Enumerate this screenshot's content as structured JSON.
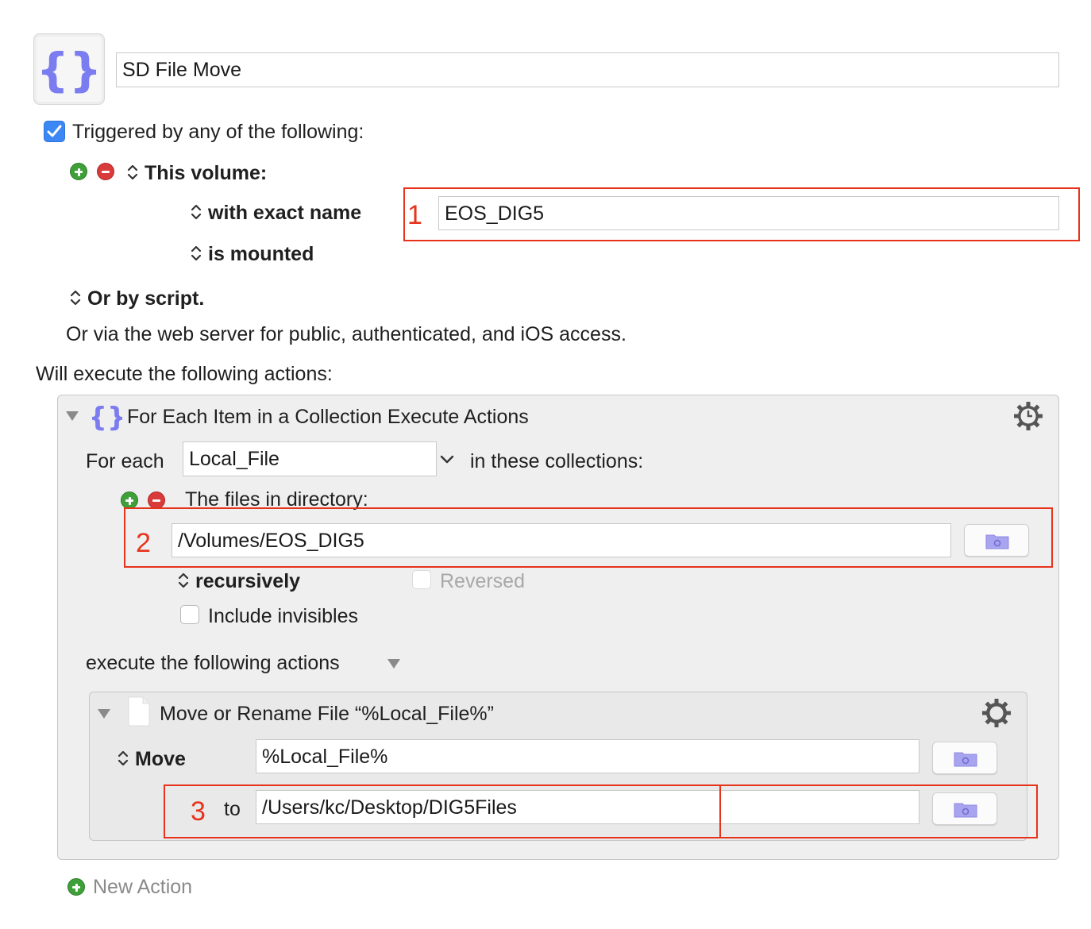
{
  "macro": {
    "icon": "curly-braces-icon",
    "name": "SD File Move"
  },
  "trigger": {
    "checked": true,
    "label": "Triggered by any of the following:",
    "volume_label": "This volume:",
    "condition_label": "with exact name",
    "volume_name": "EOS_DIG5",
    "state_label": "is mounted",
    "script_label": "Or by script.",
    "webserver_text": "Or via the web server for public, authenticated, and iOS access."
  },
  "actions_label": "Will execute the following actions:",
  "for_each_action": {
    "title": "For Each Item in a Collection Execute Actions",
    "for_each_label": "For each",
    "variable": "Local_File",
    "collections_label": "in these collections:",
    "collection_label": "The files in directory:",
    "directory": "/Volumes/EOS_DIG5",
    "recursively_label": "recursively",
    "reversed_label": "Reversed",
    "include_invisibles_label": "Include invisibles",
    "execute_label": "execute the following actions"
  },
  "move_action": {
    "title": "Move or Rename File “%Local_File%”",
    "move_label": "Move",
    "source": "%Local_File%",
    "to_label": "to",
    "destination": "/Users/kc/Desktop/DIG5Files"
  },
  "annotations": [
    "1",
    "2",
    "3"
  ],
  "new_action_label": "New Action",
  "colors": {
    "accent_blue": "#3a87f5",
    "annotation_red": "#e8331c",
    "add_green": "#3fa03a",
    "remove_red": "#d93a3a",
    "icon_purple": "#7b7cf0"
  }
}
